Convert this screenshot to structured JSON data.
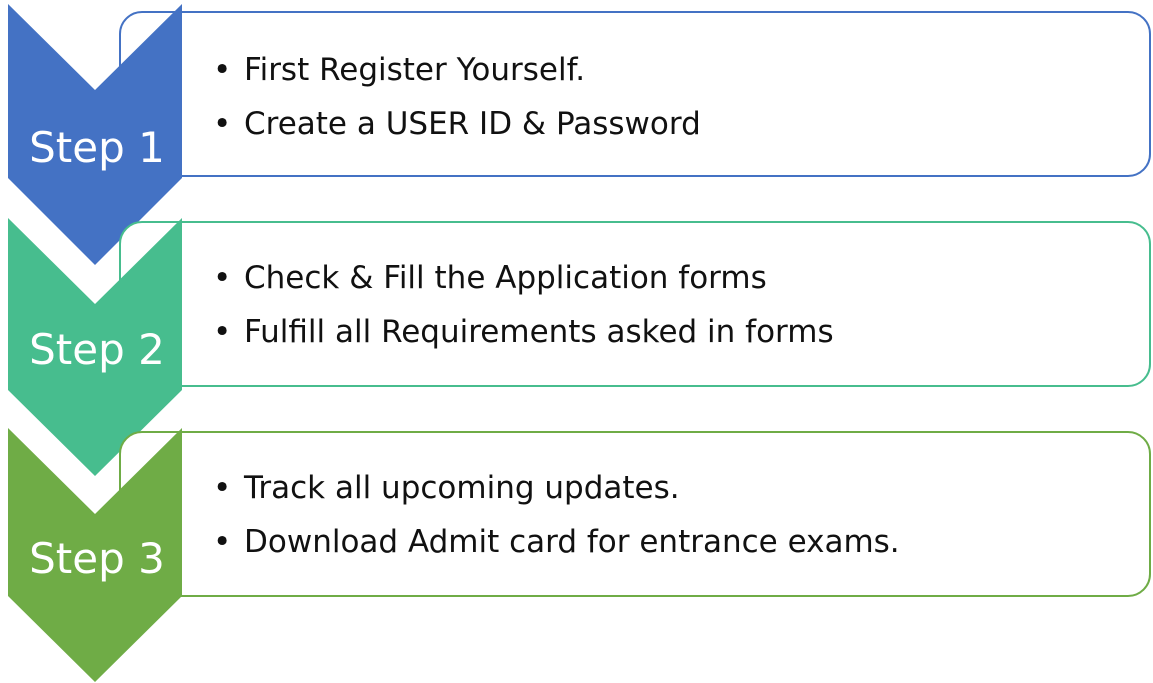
{
  "steps": [
    {
      "label": "Step 1",
      "color": "#4472C4",
      "bullets": [
        "First Register Yourself.",
        "Create a USER ID & Password"
      ]
    },
    {
      "label": "Step 2",
      "color": "#47BD8E",
      "bullets": [
        "Check & Fill the Application forms",
        "Fulfill all Requirements asked in forms"
      ]
    },
    {
      "label": "Step 3",
      "color": "#6FAC46",
      "bullets": [
        "Track all upcoming updates.",
        "Download Admit card for entrance exams."
      ]
    }
  ]
}
